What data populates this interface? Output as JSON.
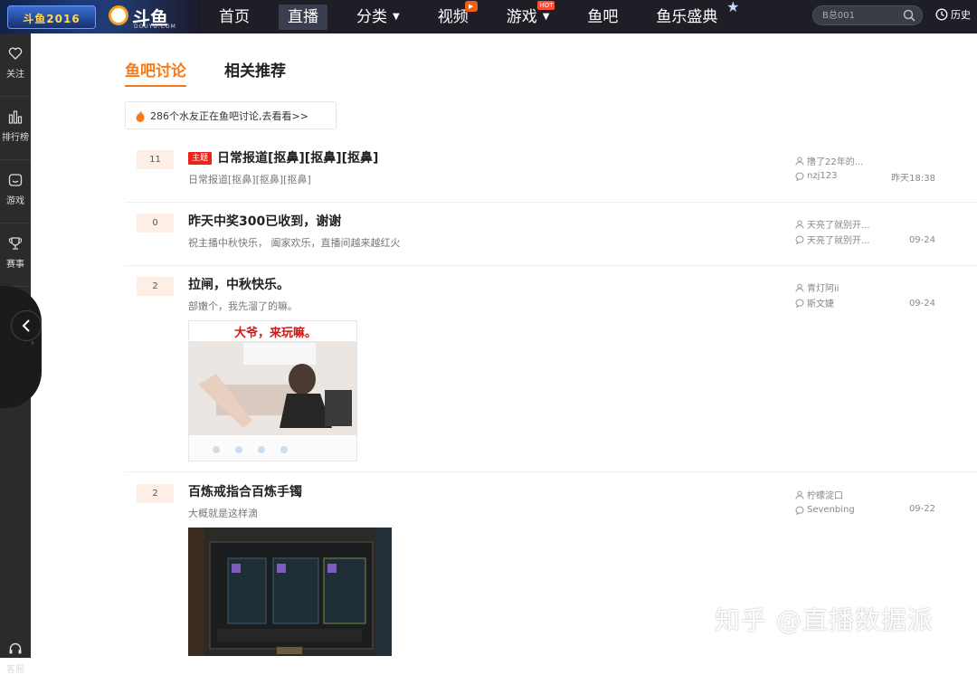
{
  "brand": {
    "banner_text": "斗鱼2016",
    "logo_text": "斗鱼",
    "logo_sub": "DOUYU.COM"
  },
  "nav": {
    "items": [
      {
        "label": "首页"
      },
      {
        "label": "直播",
        "active": true
      },
      {
        "label": "分类"
      },
      {
        "label": "视频"
      },
      {
        "label": "游戏",
        "badge": "HOT"
      },
      {
        "label": "鱼吧"
      },
      {
        "label": "鱼乐盛典"
      }
    ],
    "search_placeholder": "B总001",
    "history_label": "历史"
  },
  "sidebar": {
    "items": [
      {
        "label": "关注",
        "icon": "heart-icon"
      },
      {
        "label": "排行榜",
        "icon": "bar-chart-icon"
      },
      {
        "label": "游戏",
        "icon": "gamepad-icon"
      },
      {
        "label": "赛事",
        "icon": "trophy-icon"
      }
    ],
    "service_label": "客服"
  },
  "tabs": [
    {
      "label": "鱼吧讨论",
      "active": true
    },
    {
      "label": "相关推荐"
    }
  ],
  "notice": "286个水友正在鱼吧讨论,去看看>>",
  "posts": [
    {
      "count": "11",
      "tag": "主题",
      "title": "日常报道[抠鼻][抠鼻][抠鼻]",
      "desc": "日常报道[抠鼻][抠鼻][抠鼻]",
      "author": "撸了22年的...",
      "last_reply": "nzj123",
      "time": "昨天18:38"
    },
    {
      "count": "0",
      "title": "昨天中奖300已收到，谢谢",
      "desc": "祝主播中秋快乐， 阖家欢乐，直播间越来越红火",
      "author": "天亮了就别开...",
      "last_reply": "天亮了就别开...",
      "time": "09-24"
    },
    {
      "count": "2",
      "title": "拉闸，中秋快乐。",
      "desc": "部嫩个，我先溜了的嘛。",
      "image_caption": "大爷，来玩嘛。",
      "author": "青灯阿ii",
      "last_reply": "斯文婕",
      "time": "09-24"
    },
    {
      "count": "2",
      "title": "百炼戒指合百炼手镯",
      "desc": "大概就是这样滴",
      "author": "柠檬淀口",
      "last_reply": "Sevenbing",
      "time": "09-22"
    }
  ],
  "watermark": "知乎 @直播数据派",
  "colors": {
    "accent": "#f57a1c",
    "nav_bg": "#1e1e26",
    "sidebar_bg": "#2b2b2b",
    "tag_red": "#e8241c"
  }
}
